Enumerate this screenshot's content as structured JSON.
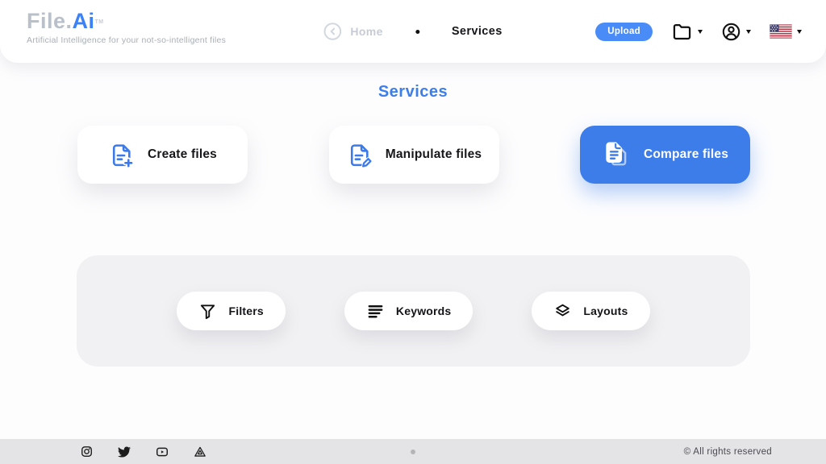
{
  "brand": {
    "name_primary": "File.",
    "name_accent": "Ai",
    "trademark": "TM",
    "tagline": "Artificial Intelligence for your not-so-intelligent files"
  },
  "nav": {
    "home_label": "Home",
    "current_label": "Services",
    "upload_label": "Upload"
  },
  "main": {
    "heading": "Services",
    "service_cards": [
      {
        "label": "Create files",
        "icon": "file-plus-icon",
        "active": false
      },
      {
        "label": "Manipulate files",
        "icon": "file-edit-icon",
        "active": false
      },
      {
        "label": "Compare files",
        "icon": "file-compare-icon",
        "active": true
      }
    ],
    "tool_buttons": [
      {
        "label": "Filters",
        "icon": "funnel-icon"
      },
      {
        "label": "Keywords",
        "icon": "text-lines-icon"
      },
      {
        "label": "Layouts",
        "icon": "layers-icon"
      }
    ]
  },
  "footer": {
    "social_icons": [
      "instagram-icon",
      "twitter-icon",
      "youtube-icon",
      "drive-icon"
    ],
    "copyright": "© All rights reserved"
  },
  "colors": {
    "accent_blue": "#3d7de9",
    "upload_blue": "#4a8cf7",
    "heading_blue": "#3e7ee9",
    "logo_gray": "#b9c0ca",
    "panel_gray": "#f1f1f3",
    "footer_gray": "#e4e4e6"
  }
}
